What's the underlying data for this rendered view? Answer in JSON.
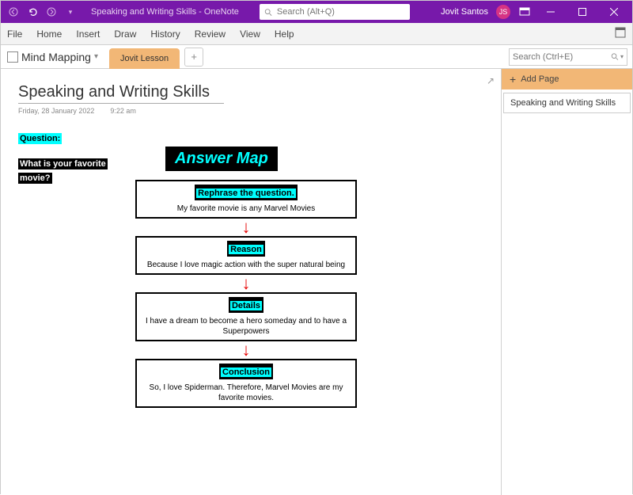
{
  "titlebar": {
    "title": "Speaking and Writing Skills  -  OneNote",
    "search_placeholder": "Search (Alt+Q)",
    "user_name": "Jovit Santos",
    "user_initials": "JS"
  },
  "ribbon": {
    "tabs": [
      "File",
      "Home",
      "Insert",
      "Draw",
      "History",
      "Review",
      "View",
      "Help"
    ]
  },
  "sectionbar": {
    "notebook": "Mind Mapping",
    "section_tab": "Jovit Lesson",
    "search_placeholder": "Search (Ctrl+E)"
  },
  "page": {
    "title": "Speaking and Writing Skills",
    "date": "Friday, 28 January 2022",
    "time": "9:22 am"
  },
  "question": {
    "label": "Question:",
    "text_line1": "What is your favorite",
    "text_line2": "movie?"
  },
  "answer_map": {
    "title": "Answer Map",
    "boxes": [
      {
        "label": "Rephrase the question.",
        "text": "My favorite movie is any Marvel Movies"
      },
      {
        "label": "Reason",
        "text": "Because I love magic action with the super natural being"
      },
      {
        "label": "Details",
        "text": "I have a  dream to become a hero someday and to have a Superpowers"
      },
      {
        "label": "Conclusion",
        "text": "So, I love Spiderman. Therefore, Marvel Movies are my favorite movies."
      }
    ]
  },
  "sidebar": {
    "add_page": "Add Page",
    "pages": [
      "Speaking and Writing Skills"
    ]
  }
}
